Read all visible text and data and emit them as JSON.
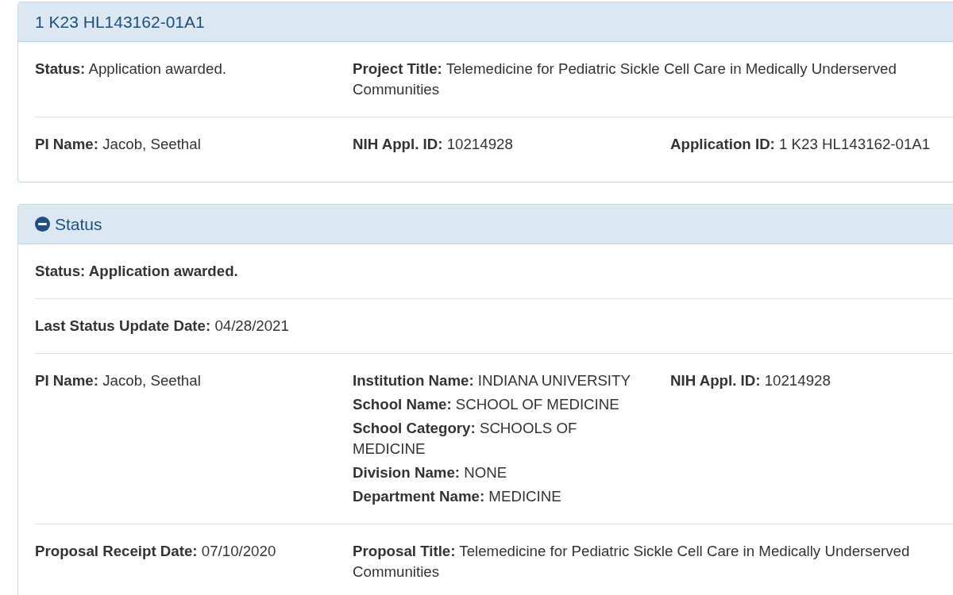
{
  "panels": [
    {
      "title": "1 K23 HL143162-01A1",
      "rows": [
        {
          "columns": [
            {
              "items": [
                {
                  "kind": "field",
                  "label": "Status:",
                  "value": "Application awarded."
                }
              ]
            },
            {
              "items": [
                {
                  "kind": "field",
                  "label": "Project Title:",
                  "value": "Telemedicine for Pediatric Sickle Cell Care in Medically Underserved Communities"
                }
              ]
            }
          ]
        },
        {
          "columns": [
            {
              "items": [
                {
                  "kind": "field",
                  "label": "PI Name:",
                  "value": "Jacob, Seethal"
                }
              ]
            },
            {
              "items": [
                {
                  "kind": "field",
                  "label": "NIH Appl. ID:",
                  "value": "10214928"
                }
              ]
            },
            {
              "items": [
                {
                  "kind": "field",
                  "label": "Application ID:",
                  "value": "1 K23 HL143162-01A1"
                }
              ]
            }
          ]
        }
      ]
    },
    {
      "title": "Status",
      "toggle": {
        "expanded": true
      },
      "rows": [
        {
          "columns": [
            {
              "items": [
                {
                  "kind": "strong",
                  "text": "Status: Application awarded."
                }
              ]
            }
          ]
        },
        {
          "columns": [
            {
              "items": [
                {
                  "kind": "field",
                  "label": "Last Status Update Date:",
                  "value": "04/28/2021"
                }
              ]
            }
          ]
        },
        {
          "columns": [
            {
              "items": [
                {
                  "kind": "field",
                  "label": "PI Name:",
                  "value": "Jacob, Seethal"
                }
              ]
            },
            {
              "items": [
                {
                  "kind": "field",
                  "label": "Institution Name:",
                  "value": "INDIANA UNIVERSITY"
                },
                {
                  "kind": "field",
                  "label": "School Name:",
                  "value": "SCHOOL OF MEDICINE"
                },
                {
                  "kind": "field",
                  "label": "School Category:",
                  "value": "SCHOOLS OF MEDICINE"
                },
                {
                  "kind": "field",
                  "label": "Division Name:",
                  "value": "NONE"
                },
                {
                  "kind": "field",
                  "label": "Department Name:",
                  "value": "MEDICINE"
                }
              ]
            },
            {
              "items": [
                {
                  "kind": "field",
                  "label": "NIH Appl. ID:",
                  "value": "10214928"
                }
              ]
            }
          ]
        },
        {
          "columns": [
            {
              "items": [
                {
                  "kind": "field",
                  "label": "Proposal Receipt Date:",
                  "value": "07/10/2020"
                }
              ]
            },
            {
              "items": [
                {
                  "kind": "field",
                  "label": "Proposal Title:",
                  "value": "Telemedicine for Pediatric Sickle Cell Care in Medically Underserved Communities"
                }
              ]
            }
          ]
        }
      ]
    }
  ]
}
